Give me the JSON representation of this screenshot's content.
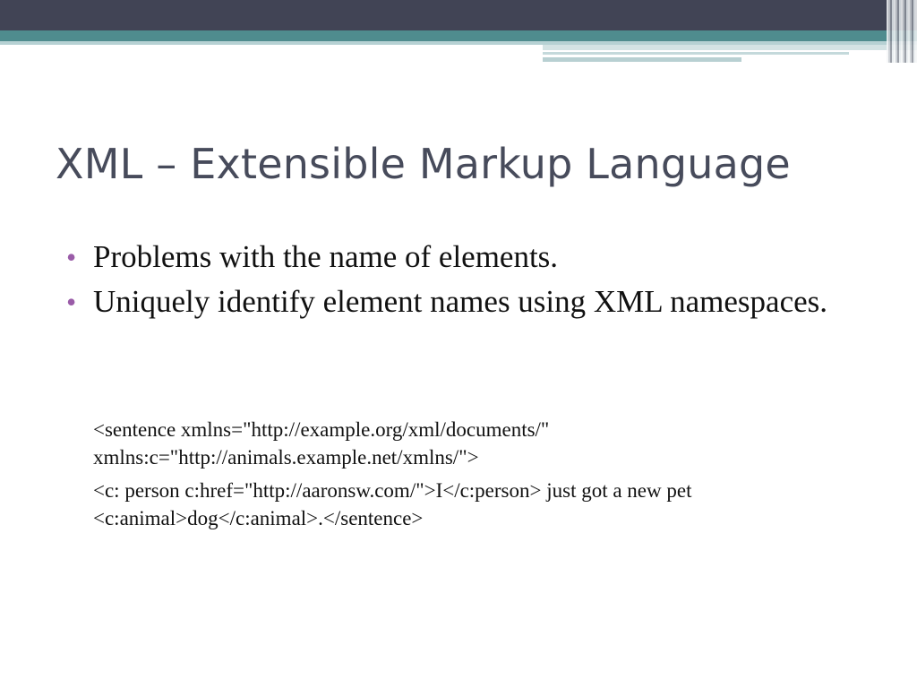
{
  "slide": {
    "title": "XML – Extensible Markup Language",
    "bullets": [
      {
        "text": "Problems with the name of elements."
      },
      {
        "text": "Uniquely identify element names using XML namespaces."
      }
    ],
    "bullet_glyph": "•",
    "code_lines": [
      "<sentence     xmlns=\"http://example.org/xml/documents/\" xmlns:c=\"http://animals.example.net/xmlns/\">",
      "<c: person c:href=\"http://aaronsw.com/\">I</c:person> just got a new pet <c:animal>dog</c:animal>.</sentence>"
    ]
  },
  "colors": {
    "header_dark": "#414455",
    "header_teal": "#4f8c8e",
    "title_text": "#474b5b",
    "bullet_accent": "#9a5ca8"
  }
}
